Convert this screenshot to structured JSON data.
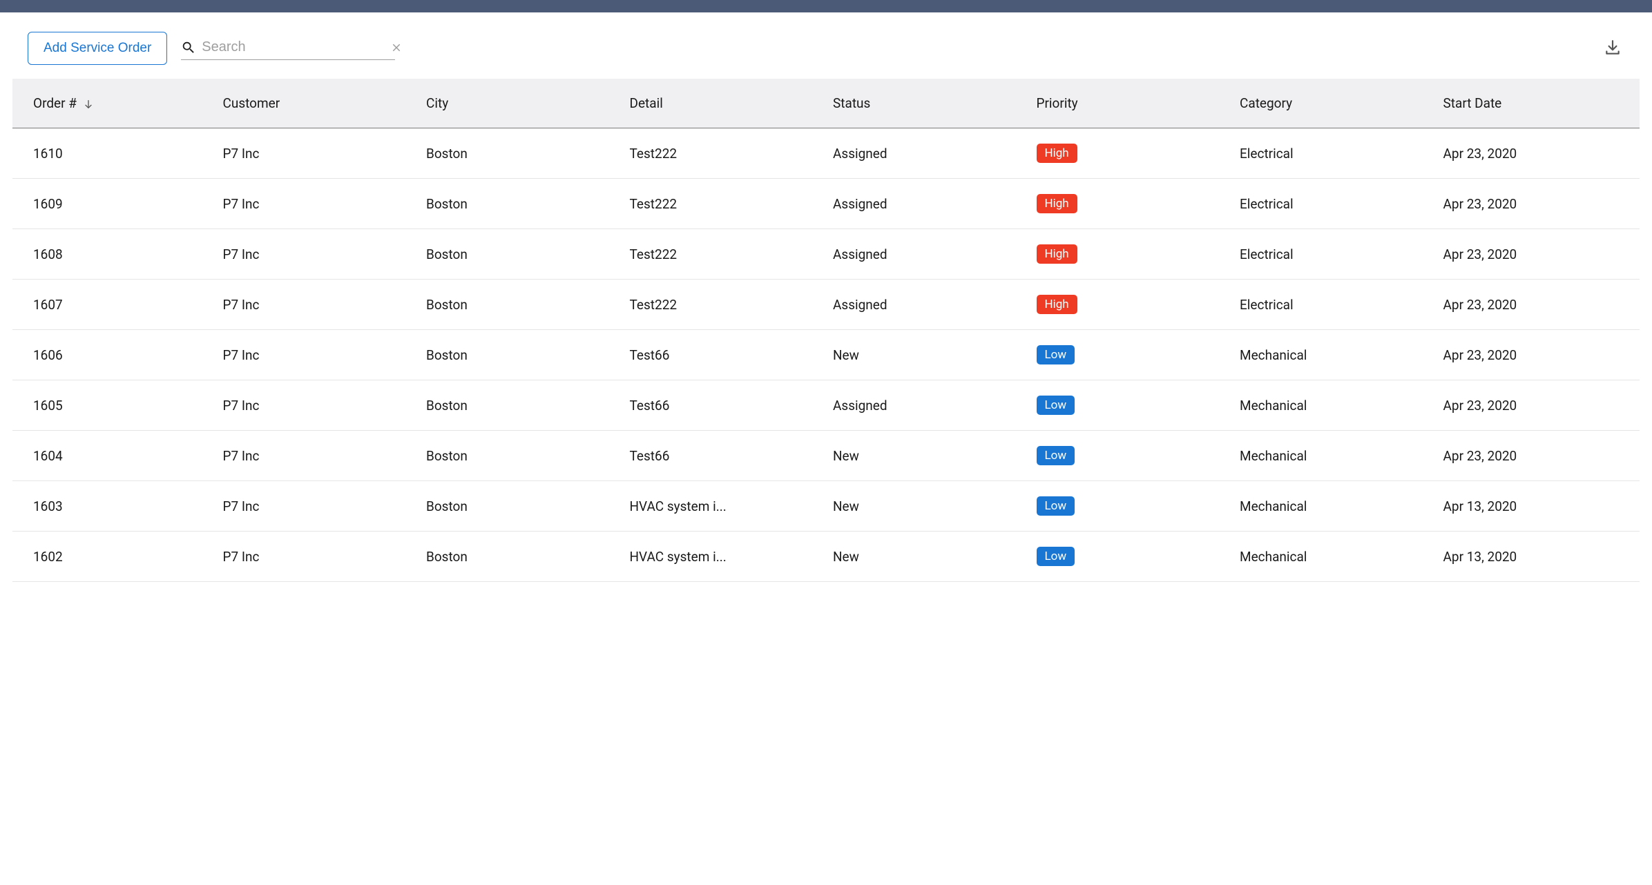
{
  "toolbar": {
    "add_label": "Add Service Order",
    "search_placeholder": "Search"
  },
  "table": {
    "columns": {
      "order": "Order #",
      "customer": "Customer",
      "city": "City",
      "detail": "Detail",
      "status": "Status",
      "priority": "Priority",
      "category": "Category",
      "start_date": "Start Date"
    },
    "rows": [
      {
        "order": "1610",
        "customer": "P7 Inc",
        "city": "Boston",
        "detail": "Test222",
        "status": "Assigned",
        "priority": "High",
        "category": "Electrical",
        "start_date": "Apr 23, 2020"
      },
      {
        "order": "1609",
        "customer": "P7 Inc",
        "city": "Boston",
        "detail": "Test222",
        "status": "Assigned",
        "priority": "High",
        "category": "Electrical",
        "start_date": "Apr 23, 2020"
      },
      {
        "order": "1608",
        "customer": "P7 Inc",
        "city": "Boston",
        "detail": "Test222",
        "status": "Assigned",
        "priority": "High",
        "category": "Electrical",
        "start_date": "Apr 23, 2020"
      },
      {
        "order": "1607",
        "customer": "P7 Inc",
        "city": "Boston",
        "detail": "Test222",
        "status": "Assigned",
        "priority": "High",
        "category": "Electrical",
        "start_date": "Apr 23, 2020"
      },
      {
        "order": "1606",
        "customer": "P7 Inc",
        "city": "Boston",
        "detail": "Test66",
        "status": "New",
        "priority": "Low",
        "category": "Mechanical",
        "start_date": "Apr 23, 2020"
      },
      {
        "order": "1605",
        "customer": "P7 Inc",
        "city": "Boston",
        "detail": "Test66",
        "status": "Assigned",
        "priority": "Low",
        "category": "Mechanical",
        "start_date": "Apr 23, 2020"
      },
      {
        "order": "1604",
        "customer": "P7 Inc",
        "city": "Boston",
        "detail": "Test66",
        "status": "New",
        "priority": "Low",
        "category": "Mechanical",
        "start_date": "Apr 23, 2020"
      },
      {
        "order": "1603",
        "customer": "P7 Inc",
        "city": "Boston",
        "detail": "HVAC system i...",
        "status": "New",
        "priority": "Low",
        "category": "Mechanical",
        "start_date": "Apr 13, 2020"
      },
      {
        "order": "1602",
        "customer": "P7 Inc",
        "city": "Boston",
        "detail": "HVAC system i...",
        "status": "New",
        "priority": "Low",
        "category": "Mechanical",
        "start_date": "Apr 13, 2020"
      }
    ]
  },
  "priority_colors": {
    "High": "badge-high",
    "Low": "badge-low"
  }
}
